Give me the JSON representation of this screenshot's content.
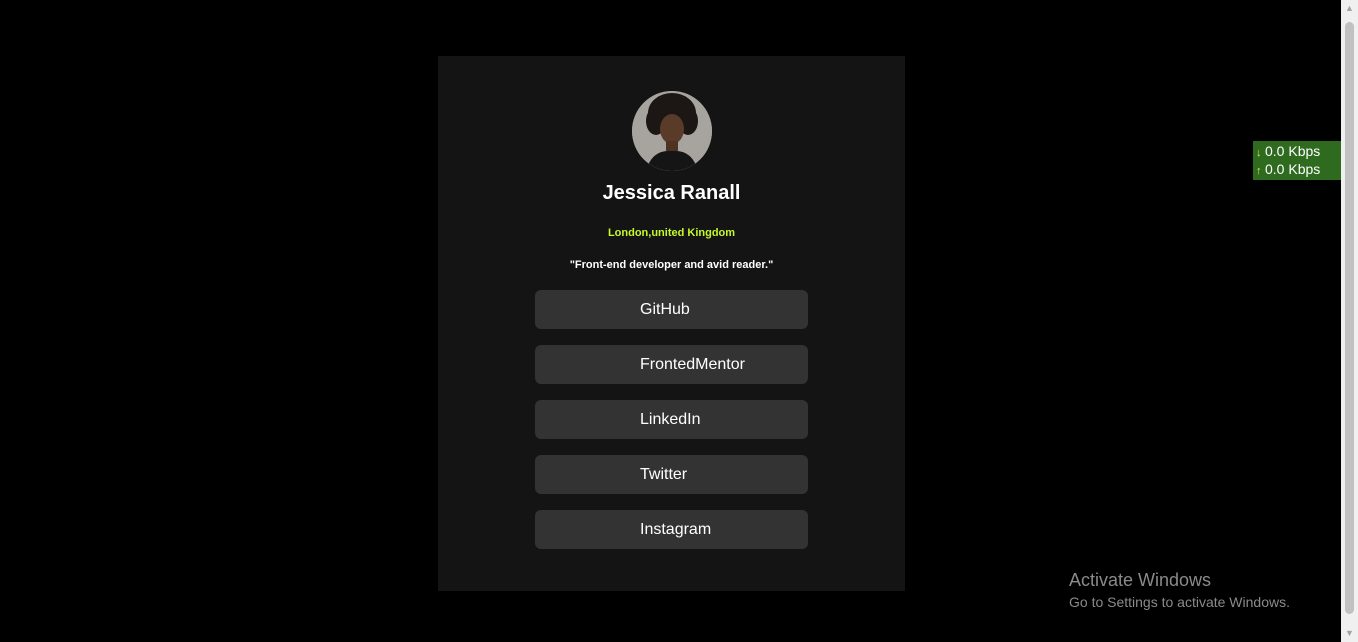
{
  "profile": {
    "name": "Jessica Ranall",
    "location": "London,united Kingdom",
    "bio": "\"Front-end developer and avid reader.\""
  },
  "links": [
    {
      "label": "GitHub"
    },
    {
      "label": "FrontedMentor"
    },
    {
      "label": "LinkedIn"
    },
    {
      "label": "Twitter"
    },
    {
      "label": "Instagram"
    }
  ],
  "netmeter": {
    "download": "0.0 Kbps",
    "upload": "0.0 Kbps"
  },
  "watermark": {
    "title": "Activate Windows",
    "subtitle": "Go to Settings to activate Windows."
  },
  "colors": {
    "page_bg": "#000000",
    "card_bg": "#141414",
    "button_bg": "#333333",
    "accent_green": "#c4f82a",
    "netmeter_bg": "#2e6b1f"
  },
  "icons": {
    "download": "download-arrow-icon",
    "upload": "upload-arrow-icon",
    "scroll_up": "scroll-up-arrow-icon",
    "scroll_down": "scroll-down-arrow-icon"
  }
}
